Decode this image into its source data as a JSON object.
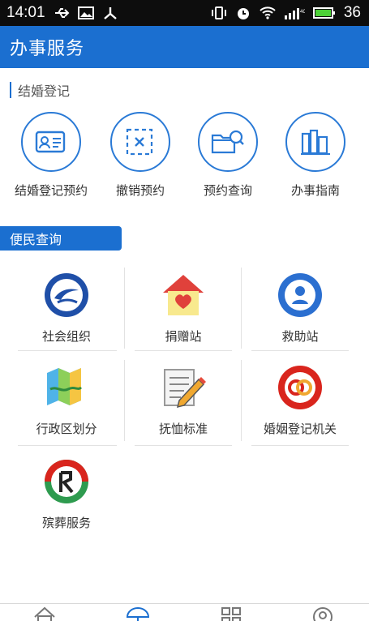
{
  "status_bar": {
    "time": "14:01",
    "signal_label": "36",
    "icons": [
      "usb-icon",
      "image-icon",
      "network-share-icon",
      "vibrate-icon",
      "alarm-icon",
      "wifi-icon",
      "signal-icon",
      "battery-icon"
    ]
  },
  "header": {
    "title": "办事服务"
  },
  "marriage_section": {
    "title": "结婚登记",
    "actions": [
      {
        "label": "结婚登记预约",
        "icon": "id-card-icon"
      },
      {
        "label": "撤销预约",
        "icon": "cancel-box-icon"
      },
      {
        "label": "预约查询",
        "icon": "folder-search-icon"
      },
      {
        "label": "办事指南",
        "icon": "books-icon"
      }
    ]
  },
  "public_section": {
    "title": "便民查询",
    "items": [
      {
        "label": "社会组织",
        "icon": "social-organization-logo"
      },
      {
        "label": "捐赠站",
        "icon": "heart-house-icon"
      },
      {
        "label": "救助站",
        "icon": "rescue-station-logo"
      },
      {
        "label": "行政区划分",
        "icon": "map-icon"
      },
      {
        "label": "抚恤标准",
        "icon": "notepad-pencil-icon"
      },
      {
        "label": "婚姻登记机关",
        "icon": "marriage-registry-logo"
      },
      {
        "label": "殡葬服务",
        "icon": "funeral-service-logo"
      }
    ]
  },
  "bottom_nav": {
    "items": [
      "home-icon",
      "umbrella-icon",
      "grid-icon",
      "profile-icon"
    ]
  },
  "colors": {
    "primary": "#1b6fd0",
    "status_bar": "#0d0d0d",
    "circle_border": "#2a7ad6"
  }
}
